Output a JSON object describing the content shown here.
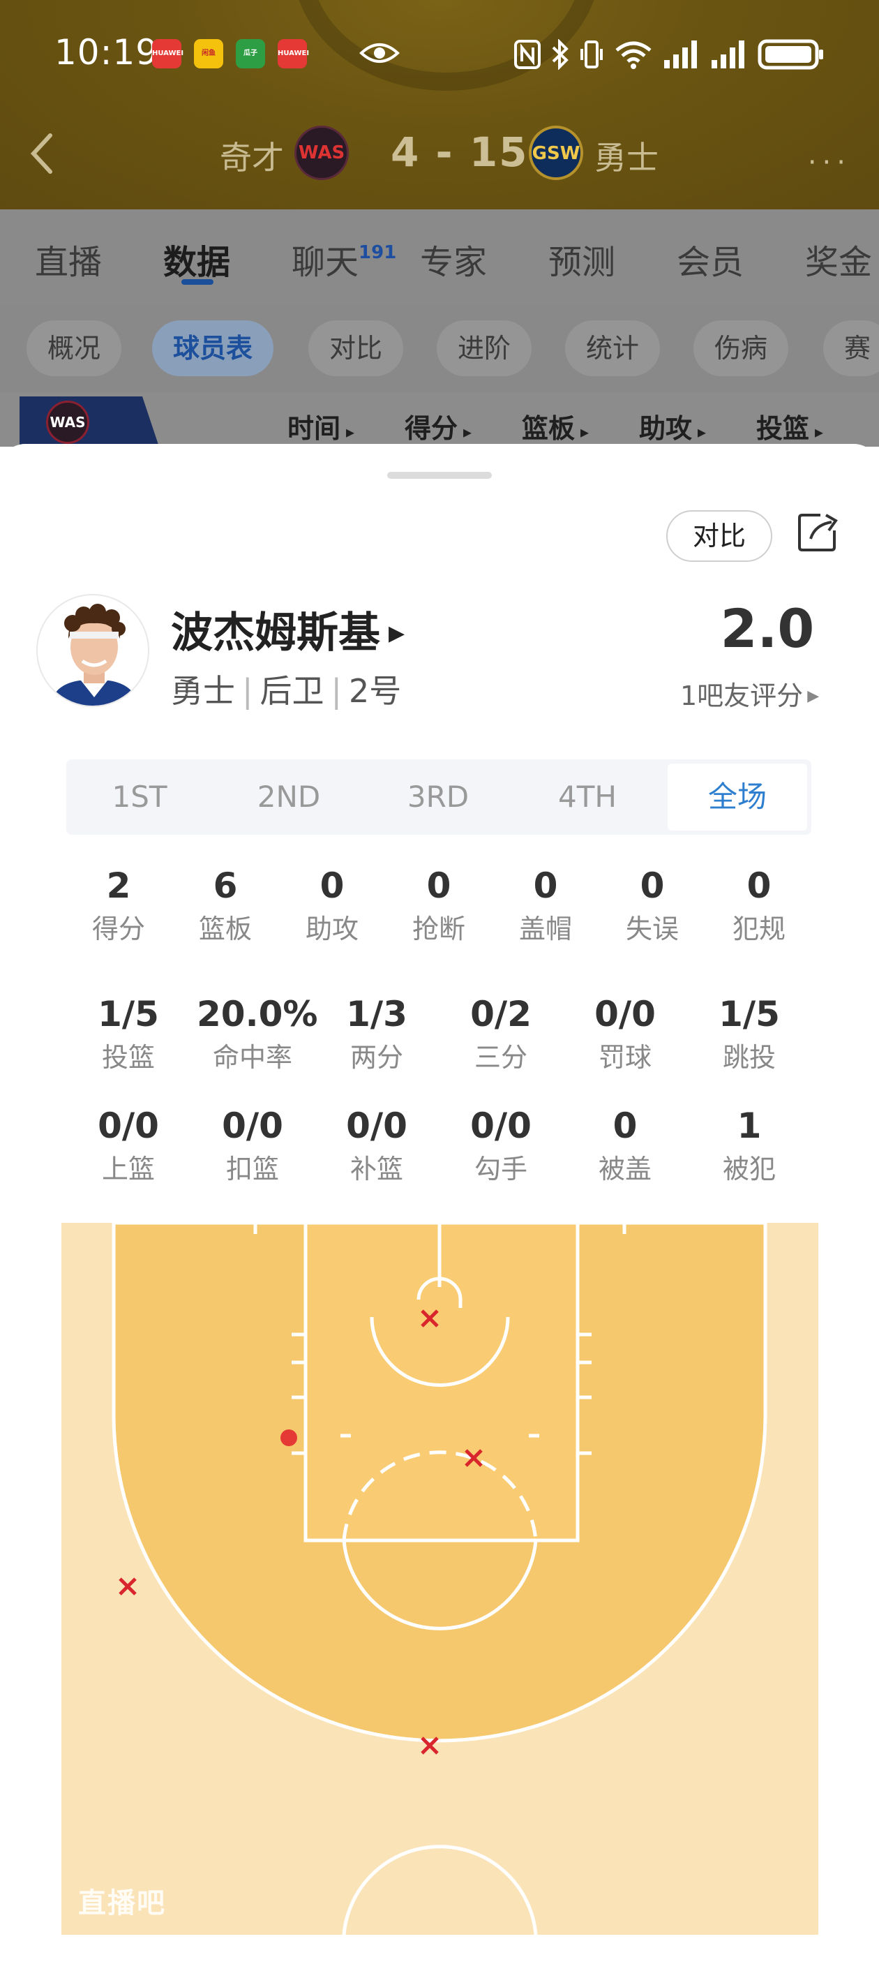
{
  "status_bar": {
    "time": "10:19",
    "app_badges": [
      "HUAWEI",
      "闲鱼",
      "瓜子",
      "HUAWEI"
    ],
    "battery_icon": "battery-icon"
  },
  "game_header": {
    "home_team": "奇才",
    "home_abbr": "WAS",
    "score": "4 - 15",
    "away_abbr": "GSW",
    "away_team": "勇士",
    "more": "···"
  },
  "tabs": [
    {
      "label": "直播"
    },
    {
      "label": "数据"
    },
    {
      "label": "聊天",
      "badge": "191"
    },
    {
      "label": "专家"
    },
    {
      "label": "预测"
    },
    {
      "label": "会员"
    },
    {
      "label": "奖金"
    }
  ],
  "sub_tabs": [
    "概况",
    "球员表",
    "对比",
    "进阶",
    "统计",
    "伤病",
    "赛"
  ],
  "columns": {
    "team_abbr": "WAS",
    "headers": [
      "时间",
      "得分",
      "篮板",
      "助攻",
      "投篮"
    ]
  },
  "sheet": {
    "compare_label": "对比",
    "player_name": "波杰姆斯基",
    "player_info": [
      "勇士",
      "后卫",
      "2号"
    ],
    "rating": "2.0",
    "rating_label": "1吧友评分",
    "periods": [
      "1ST",
      "2ND",
      "3RD",
      "4TH",
      "全场"
    ],
    "active_period": "全场",
    "stats_row1": [
      {
        "v": "2",
        "l": "得分"
      },
      {
        "v": "6",
        "l": "篮板"
      },
      {
        "v": "0",
        "l": "助攻"
      },
      {
        "v": "0",
        "l": "抢断"
      },
      {
        "v": "0",
        "l": "盖帽"
      },
      {
        "v": "0",
        "l": "失误"
      },
      {
        "v": "0",
        "l": "犯规"
      }
    ],
    "stats_row2": [
      {
        "v": "1/5",
        "l": "投篮"
      },
      {
        "v": "20.0%",
        "l": "命中率"
      },
      {
        "v": "1/3",
        "l": "两分"
      },
      {
        "v": "0/2",
        "l": "三分"
      },
      {
        "v": "0/0",
        "l": "罚球"
      },
      {
        "v": "1/5",
        "l": "跳投"
      }
    ],
    "stats_row3": [
      {
        "v": "0/0",
        "l": "上篮"
      },
      {
        "v": "0/0",
        "l": "扣篮"
      },
      {
        "v": "0/0",
        "l": "补篮"
      },
      {
        "v": "0/0",
        "l": "勾手"
      },
      {
        "v": "0",
        "l": "被盖"
      },
      {
        "v": "1",
        "l": "被犯"
      }
    ],
    "watermark": "直播吧",
    "colors": {
      "accent": "#2f7fd0",
      "made": "#e53935",
      "missed": "#d9262c",
      "court": "#f6c86e"
    }
  }
}
